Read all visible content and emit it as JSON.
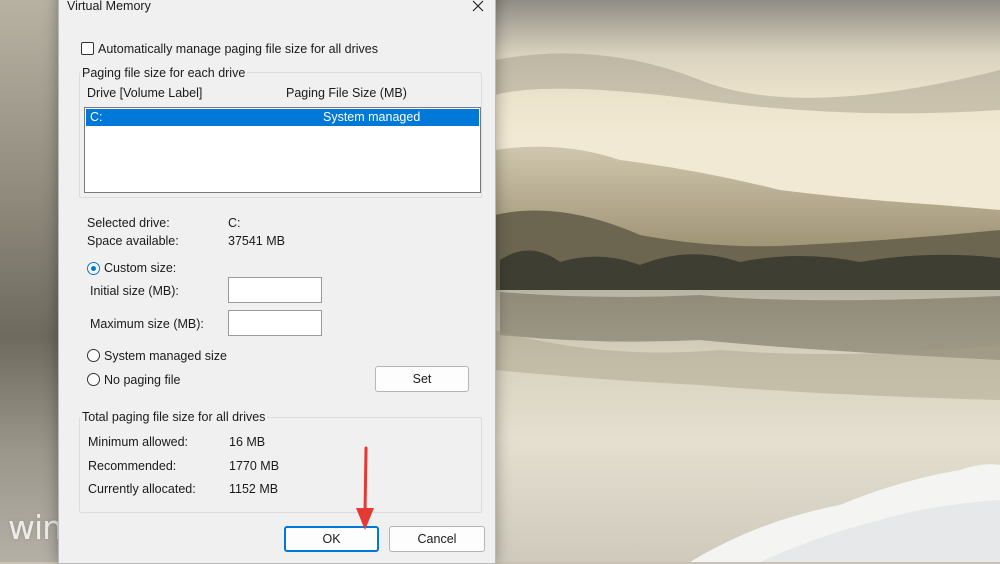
{
  "dialog": {
    "title": "Virtual Memory",
    "auto_manage_label": "Automatically manage paging file size for all drives",
    "auto_manage_checked": false
  },
  "each_drive": {
    "group_label": "Paging file size for each drive",
    "columns": [
      "Drive  [Volume Label]",
      "Paging File Size (MB)"
    ],
    "rows": [
      {
        "drive": "C:",
        "size": "System managed",
        "selected": true
      }
    ]
  },
  "selected_drive": {
    "selected_label": "Selected drive:",
    "selected_value": "C:",
    "space_label": "Space available:",
    "space_value": "37541 MB"
  },
  "options": {
    "custom_size_label": "Custom size:",
    "initial_size_label": "Initial size (MB):",
    "initial_size_value": "",
    "maximum_size_label": "Maximum size (MB):",
    "maximum_size_value": "",
    "system_managed_label": "System managed size",
    "no_paging_label": "No paging file",
    "selected_option": "custom",
    "set_label": "Set"
  },
  "totals": {
    "group_label": "Total paging file size for all drives",
    "minimum_label": "Minimum allowed:",
    "minimum_value": "16 MB",
    "recommended_label": "Recommended:",
    "recommended_value": "1770 MB",
    "allocated_label": "Currently allocated:",
    "allocated_value": "1152 MB"
  },
  "buttons": {
    "ok_label": "OK",
    "cancel_label": "Cancel"
  },
  "watermark": {
    "text": "windowsreport"
  },
  "colors": {
    "accent": "#0078d7",
    "annotation_arrow": "#e53935",
    "dialog_background": "#f0f0f0"
  },
  "icons": [
    "close-icon",
    "arrow-annotation"
  ]
}
